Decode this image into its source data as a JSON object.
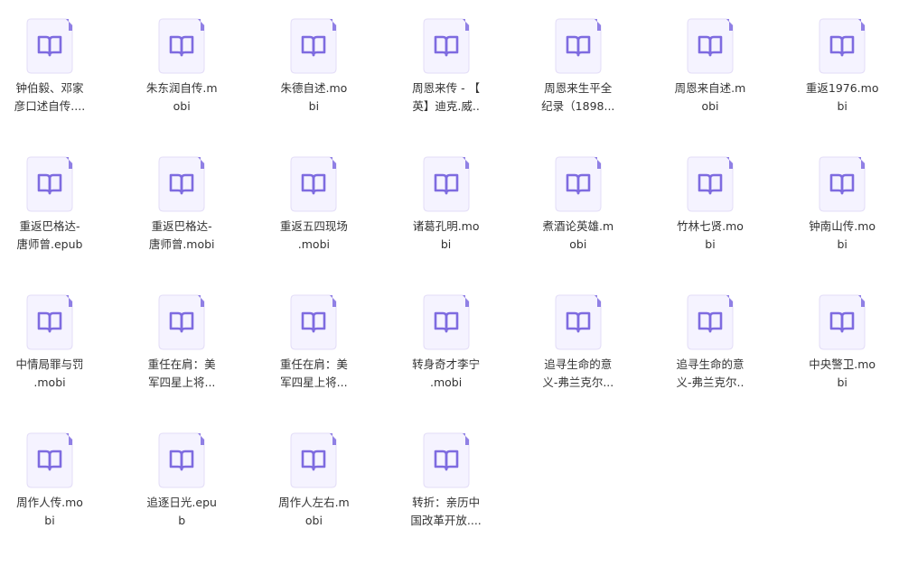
{
  "colors": {
    "page_background": "#ffffff",
    "icon_background": "#f5f3ff",
    "icon_border": "#e3ddf7",
    "icon_accent": "#7e6be0",
    "text": "#333333"
  },
  "files": [
    {
      "name_line1": "钟伯毅、邓家",
      "name_line2": "彦口述自传....",
      "icon": "ebook-file-icon"
    },
    {
      "name_line1": "朱东润自传.m",
      "name_line2": "obi",
      "icon": "ebook-file-icon"
    },
    {
      "name_line1": "朱德自述.mo",
      "name_line2": "bi",
      "icon": "ebook-file-icon"
    },
    {
      "name_line1": "周恩来传 - 【",
      "name_line2": "英】迪克.威..",
      "icon": "ebook-file-icon"
    },
    {
      "name_line1": "周恩来生平全",
      "name_line2": "纪录（1898...",
      "icon": "ebook-file-icon"
    },
    {
      "name_line1": "周恩来自述.m",
      "name_line2": "obi",
      "icon": "ebook-file-icon"
    },
    {
      "name_line1": "重返1976.mo",
      "name_line2": "bi",
      "icon": "ebook-file-icon"
    },
    {
      "name_line1": "重返巴格达-",
      "name_line2": "唐师曾.epub",
      "icon": "ebook-file-icon"
    },
    {
      "name_line1": "重返巴格达-",
      "name_line2": "唐师曾.mobi",
      "icon": "ebook-file-icon"
    },
    {
      "name_line1": "重返五四现场",
      "name_line2": ".mobi",
      "icon": "ebook-file-icon"
    },
    {
      "name_line1": "诸葛孔明.mo",
      "name_line2": "bi",
      "icon": "ebook-file-icon"
    },
    {
      "name_line1": "煮酒论英雄.m",
      "name_line2": "obi",
      "icon": "ebook-file-icon"
    },
    {
      "name_line1": "竹林七贤.mo",
      "name_line2": "bi",
      "icon": "ebook-file-icon"
    },
    {
      "name_line1": "钟南山传.mo",
      "name_line2": "bi",
      "icon": "ebook-file-icon"
    },
    {
      "name_line1": "中情局罪与罚",
      "name_line2": ".mobi",
      "icon": "ebook-file-icon"
    },
    {
      "name_line1": "重任在肩：美",
      "name_line2": "军四星上将...",
      "icon": "ebook-file-icon"
    },
    {
      "name_line1": "重任在肩：美",
      "name_line2": "军四星上将...",
      "icon": "ebook-file-icon"
    },
    {
      "name_line1": "转身奇才李宁",
      "name_line2": ".mobi",
      "icon": "ebook-file-icon"
    },
    {
      "name_line1": "追寻生命的意",
      "name_line2": "义-弗兰克尔...",
      "icon": "ebook-file-icon"
    },
    {
      "name_line1": "追寻生命的意",
      "name_line2": "义-弗兰克尔..",
      "icon": "ebook-file-icon"
    },
    {
      "name_line1": "中央警卫.mo",
      "name_line2": "bi",
      "icon": "ebook-file-icon"
    },
    {
      "name_line1": "周作人传.mo",
      "name_line2": "bi",
      "icon": "ebook-file-icon"
    },
    {
      "name_line1": "追逐日光.epu",
      "name_line2": "b",
      "icon": "ebook-file-icon"
    },
    {
      "name_line1": "周作人左右.m",
      "name_line2": "obi",
      "icon": "ebook-file-icon"
    },
    {
      "name_line1": "转折：亲历中",
      "name_line2": "国改革开放....",
      "icon": "ebook-file-icon"
    }
  ]
}
